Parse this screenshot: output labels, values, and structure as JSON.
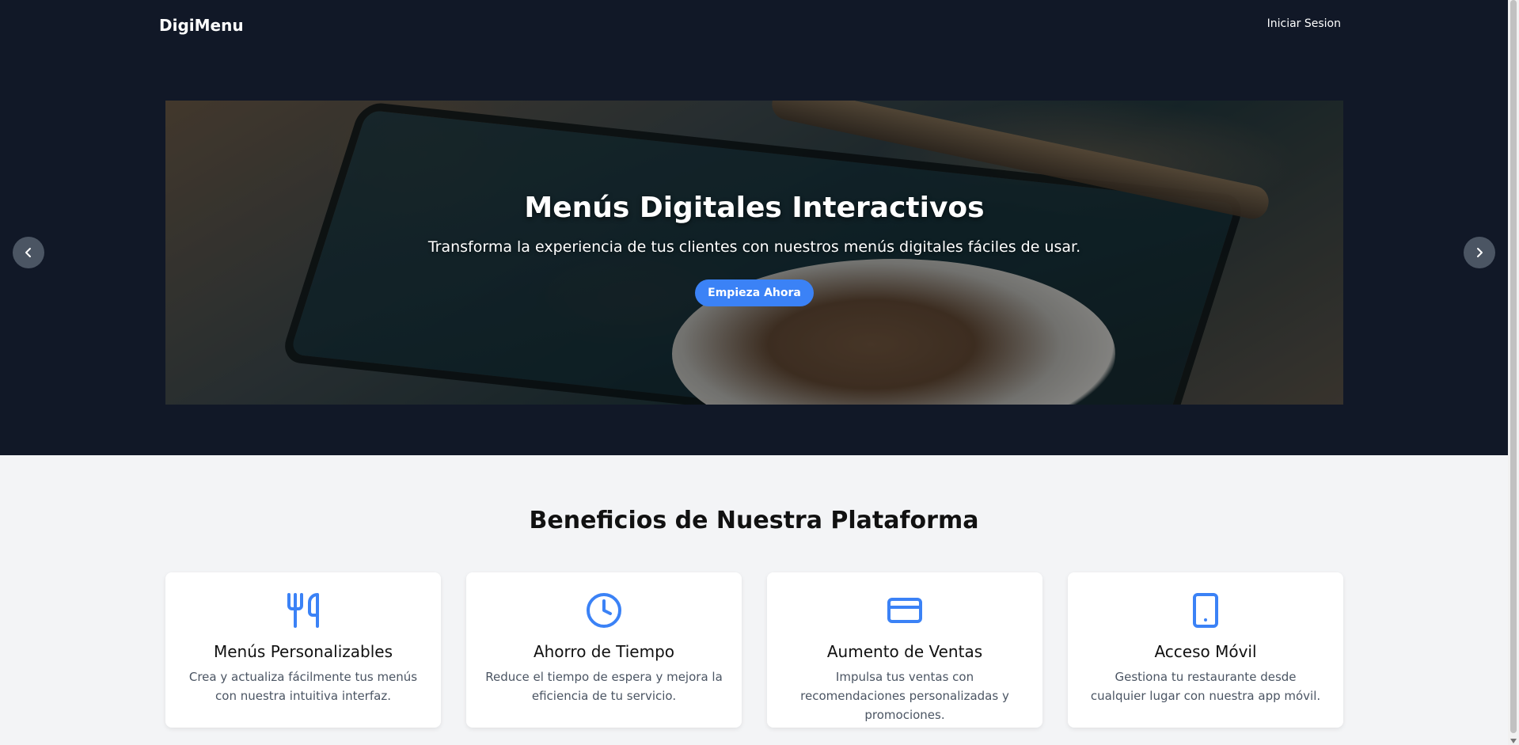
{
  "header": {
    "brand": "DigiMenu",
    "login_label": "Iniciar Sesion"
  },
  "hero": {
    "title": "Menús Digitales Interactivos",
    "subtitle": "Transforma la experiencia de tus clientes con nuestros menús digitales fáciles de usar.",
    "cta_label": "Empieza Ahora",
    "prev_icon": "chevron-left-icon",
    "next_icon": "chevron-right-icon"
  },
  "benefits": {
    "title": "Beneficios de Nuestra Plataforma",
    "cards": [
      {
        "icon": "utensils-icon",
        "title": "Menús Personalizables",
        "description": "Crea y actualiza fácilmente tus menús con nuestra intuitiva interfaz."
      },
      {
        "icon": "clock-icon",
        "title": "Ahorro de Tiempo",
        "description": "Reduce el tiempo de espera y mejora la eficiencia de tu servicio."
      },
      {
        "icon": "credit-card-icon",
        "title": "Aumento de Ventas",
        "description": "Impulsa tus ventas con recomendaciones personalizadas y promociones."
      },
      {
        "icon": "smartphone-icon",
        "title": "Acceso Móvil",
        "description": "Gestiona tu restaurante desde cualquier lugar con nuestra app móvil."
      }
    ]
  },
  "colors": {
    "dark": "#111827",
    "accent": "#3b82f6",
    "page_bg": "#f3f4f6"
  }
}
